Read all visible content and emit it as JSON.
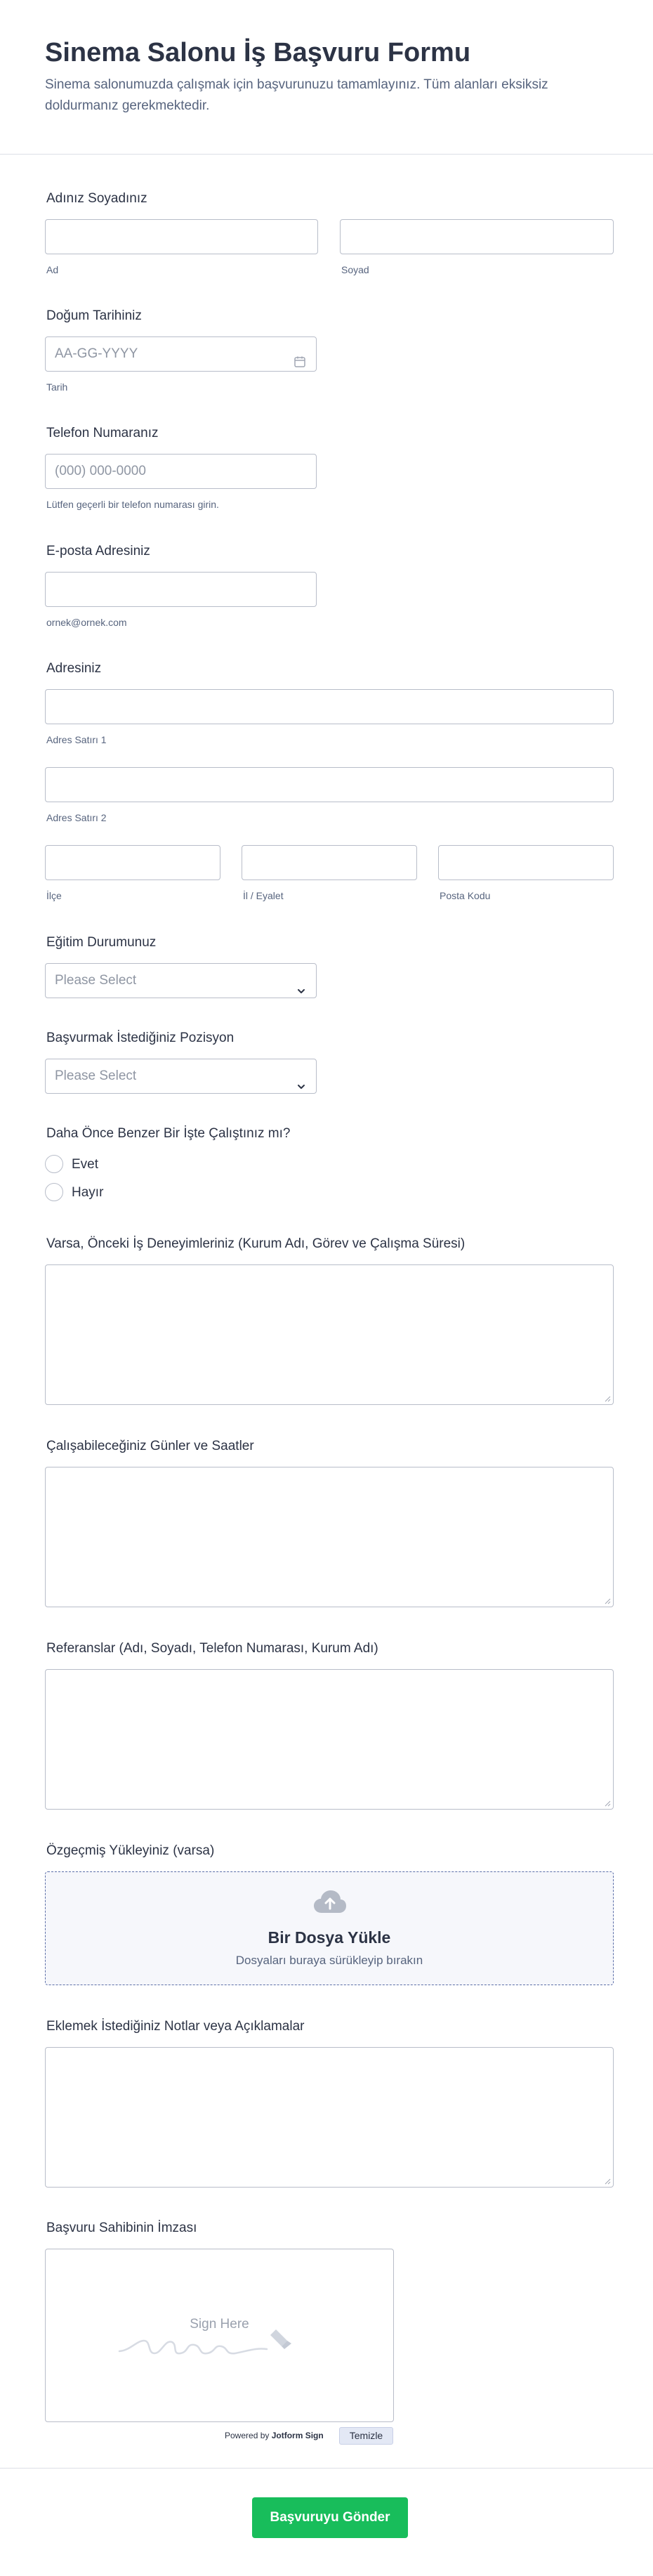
{
  "header": {
    "title": "Sinema Salonu İş Başvuru Formu",
    "subtitle": "Sinema salonumuzda çalışmak için başvurunuzu tamamlayınız. Tüm alanları eksiksiz doldurmanız gerekmektedir."
  },
  "name": {
    "label": "Adınız Soyadınız",
    "first_sub": "Ad",
    "last_sub": "Soyad"
  },
  "birth": {
    "label": "Doğum Tarihiniz",
    "placeholder": "AA-GG-YYYY",
    "sub": "Tarih",
    "icon": "calendar-icon"
  },
  "phone": {
    "label": "Telefon Numaranız",
    "placeholder": "(000) 000-0000",
    "sub": "Lütfen geçerli bir telefon numarası girin."
  },
  "email": {
    "label": "E-posta Adresiniz",
    "sub": "ornek@ornek.com"
  },
  "address": {
    "label": "Adresiniz",
    "line1_sub": "Adres Satırı 1",
    "line2_sub": "Adres Satırı 2",
    "district_sub": "İlçe",
    "state_sub": "İl / Eyalet",
    "postal_sub": "Posta Kodu"
  },
  "education": {
    "label": "Eğitim Durumunuz",
    "selected": "Please Select"
  },
  "position": {
    "label": "Başvurmak İstediğiniz Pozisyon",
    "selected": "Please Select"
  },
  "experience_q": {
    "label": "Daha Önce Benzer Bir İşte Çalıştınız mı?",
    "options": [
      "Evet",
      "Hayır"
    ]
  },
  "past_jobs": {
    "label": "Varsa, Önceki İş Deneyimleriniz (Kurum Adı, Görev ve Çalışma Süresi)"
  },
  "availability": {
    "label": "Çalışabileceğiniz Günler ve Saatler"
  },
  "references": {
    "label": "Referanslar (Adı, Soyadı, Telefon Numarası, Kurum Adı)"
  },
  "cv": {
    "label": "Özgeçmiş Yükleyiniz (varsa)",
    "title": "Bir Dosya Yükle",
    "desc": "Dosyaları buraya sürükleyip bırakın",
    "icon": "cloud-upload-icon"
  },
  "notes": {
    "label": "Eklemek İstediğiniz Notlar veya Açıklamalar"
  },
  "signature": {
    "label": "Başvuru Sahibinin İmzası",
    "placeholder": "Sign Here",
    "powered_prefix": "Powered by",
    "powered_brand": "Jotform Sign",
    "clear": "Temizle"
  },
  "submit": {
    "label": "Başvuruyu Gönder"
  },
  "colors": {
    "accent": "#18bd5b",
    "border": "#b8bdc9",
    "text": "#2c3345",
    "muted": "#57647e"
  }
}
